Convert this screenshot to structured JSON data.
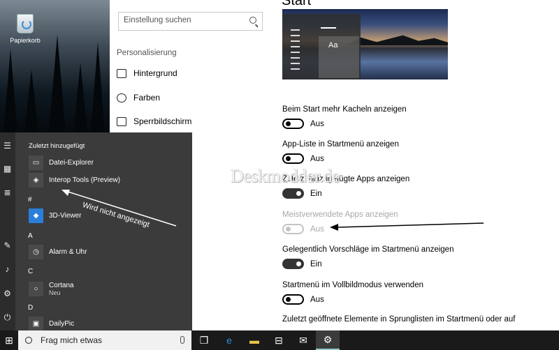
{
  "desktop": {
    "recycle_bin_label": "Papierkorb"
  },
  "settings": {
    "search_placeholder": "Einstellung suchen",
    "section_label": "Personalisierung",
    "nav": [
      {
        "label": "Hintergrund",
        "icon": "image-icon"
      },
      {
        "label": "Farben",
        "icon": "palette-icon"
      },
      {
        "label": "Sperrbildschirm",
        "icon": "lock-screen-icon"
      }
    ],
    "page_title": "Start",
    "preview_text": "Aa",
    "options": [
      {
        "label": "Beim Start mehr Kacheln anzeigen",
        "state": "Aus"
      },
      {
        "label": "App-Liste in Startmenü anzeigen",
        "state": "Aus"
      },
      {
        "label": "Zuletzt hinzugefügte Apps anzeigen",
        "state": "Ein"
      },
      {
        "label": "Meistverwendete Apps anzeigen",
        "state": "Aus"
      },
      {
        "label": "Gelegentlich Vorschläge im Startmenü anzeigen",
        "state": "Ein"
      },
      {
        "label": "Startmenü im Vollbildmodus verwenden",
        "state": "Aus"
      },
      {
        "label": "Zuletzt geöffnete Elemente in Sprunglisten im Startmenü oder auf",
        "state": ""
      }
    ]
  },
  "watermark": "Deskmodder.de",
  "startmenu": {
    "recent_header": "Zuletzt hinzugefügt",
    "recent_apps": [
      "Datei-Explorer",
      "Interop Tools (Preview)"
    ],
    "groups": [
      {
        "letter": "#",
        "apps": [
          {
            "name": "3D-Viewer",
            "sub": ""
          }
        ]
      },
      {
        "letter": "A",
        "apps": [
          {
            "name": "Alarm & Uhr",
            "sub": ""
          }
        ]
      },
      {
        "letter": "C",
        "apps": [
          {
            "name": "Cortana",
            "sub": "Neu"
          }
        ]
      },
      {
        "letter": "D",
        "apps": [
          {
            "name": "DailyPic",
            "sub": ""
          }
        ]
      }
    ]
  },
  "annotation": "Wird nicht angezeigt",
  "taskbar": {
    "search_text": "Frag mich etwas"
  },
  "colors": {
    "accent_tile": "#2b7fd8",
    "toggle_on": "#333333",
    "disabled": "#a8a8a8"
  }
}
